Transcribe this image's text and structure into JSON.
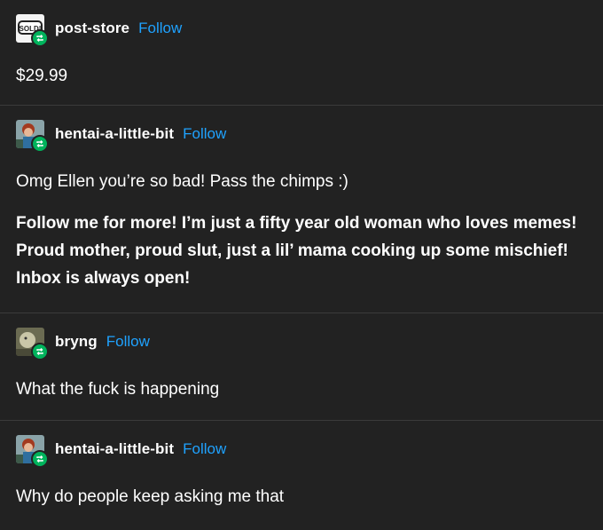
{
  "posts": [
    {
      "username": "post-store",
      "follow_label": "Follow",
      "avatar_text": "SOLD!",
      "paragraphs": [
        "$29.99"
      ]
    },
    {
      "username": "hentai-a-little-bit",
      "follow_label": "Follow",
      "paragraphs": [
        "Omg Ellen you’re so bad! Pass the chimps :)",
        "Follow me for more! I’m just a fifty year old woman who loves memes! Proud mother, proud slut, just a lil’ mama cooking up some mischief! Inbox is always open!"
      ]
    },
    {
      "username": "bryng",
      "follow_label": "Follow",
      "paragraphs": [
        "What the fuck is happening"
      ]
    },
    {
      "username": "hentai-a-little-bit",
      "follow_label": "Follow",
      "paragraphs": [
        "Why do people keep asking me that"
      ]
    }
  ],
  "colors": {
    "background": "#222222",
    "follow": "#1fa2ff",
    "reblog_badge": "#00b35c",
    "divider": "#3b3b3b"
  },
  "icons": {
    "reblog_badge": "reblog-icon"
  }
}
